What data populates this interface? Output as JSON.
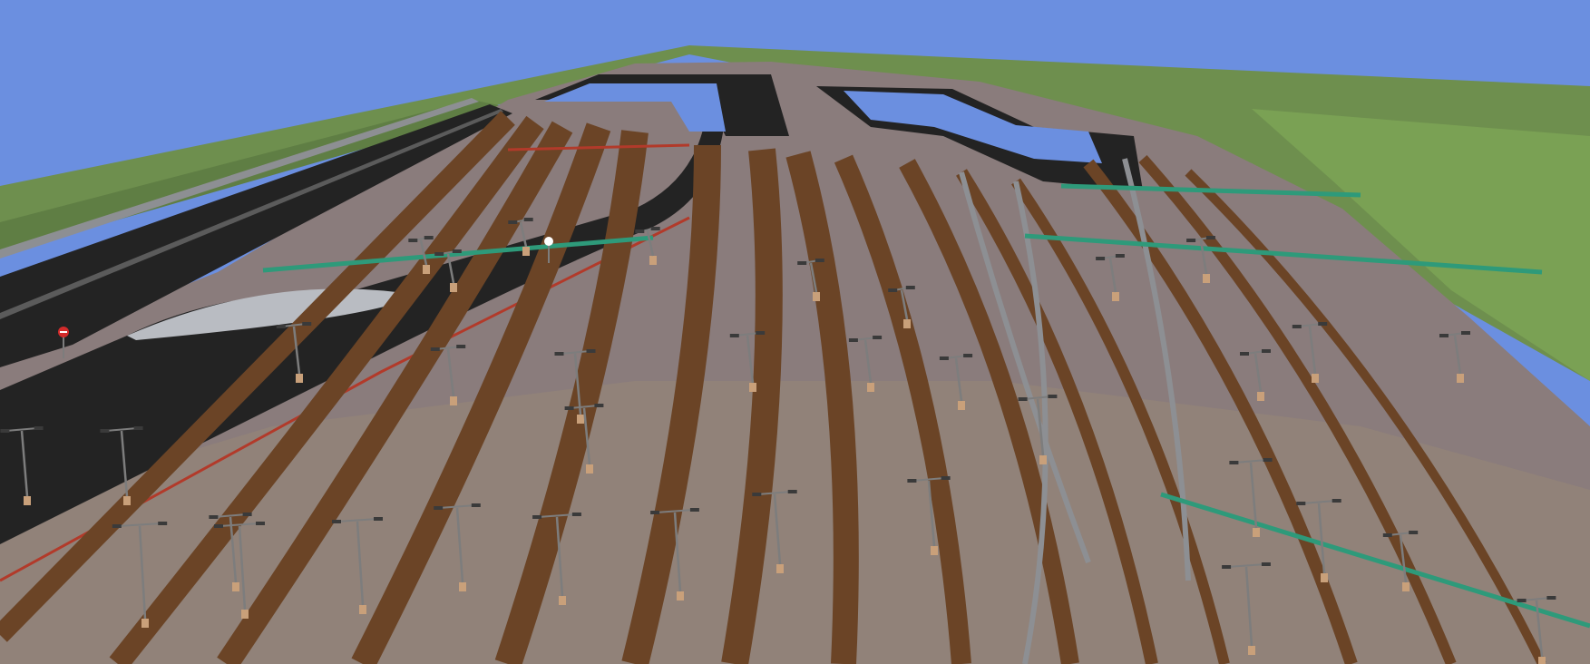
{
  "viewport": {
    "name": "3d-railway-yard-view",
    "sky_color": "#6b8fe0",
    "grass_color": "#6e8f4e",
    "ground_color": "#8a7c7c",
    "track_color": "#6b4426",
    "road_color": "#232323",
    "sidewalk_color": "#b9bcc2",
    "curb_color": "#8d8f93",
    "pole_color": "#7d7d7d",
    "lamp_color": "#3a3a3a",
    "post_base_color": "#c9a07a",
    "wire_color": "#2e9a7a",
    "rail_red_color": "#b23a2a"
  },
  "road_sign": {
    "icon": "no-entry-sign-icon",
    "color": "#d22b2b"
  }
}
